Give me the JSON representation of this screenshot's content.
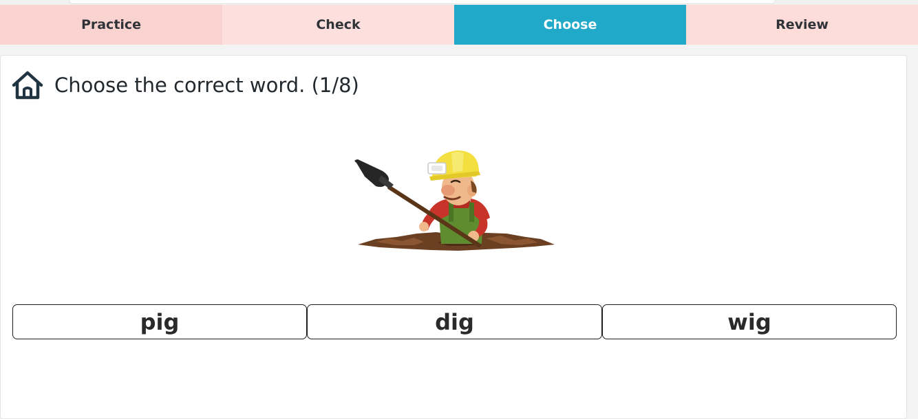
{
  "tabs": [
    {
      "label": "Practice"
    },
    {
      "label": "Check"
    },
    {
      "label": "Choose"
    },
    {
      "label": "Review"
    }
  ],
  "active_tab": "Choose",
  "colors": {
    "active_tab": "#21a9c9",
    "inactive_tab": "#fde0dd",
    "text": "#23282d"
  },
  "header": {
    "icon": "home-icon",
    "title": "Choose the correct word. (1/8)"
  },
  "illustration": {
    "icon": "digging-worker-illustration"
  },
  "choices": [
    {
      "label": "pig"
    },
    {
      "label": "dig"
    },
    {
      "label": "wig"
    }
  ]
}
